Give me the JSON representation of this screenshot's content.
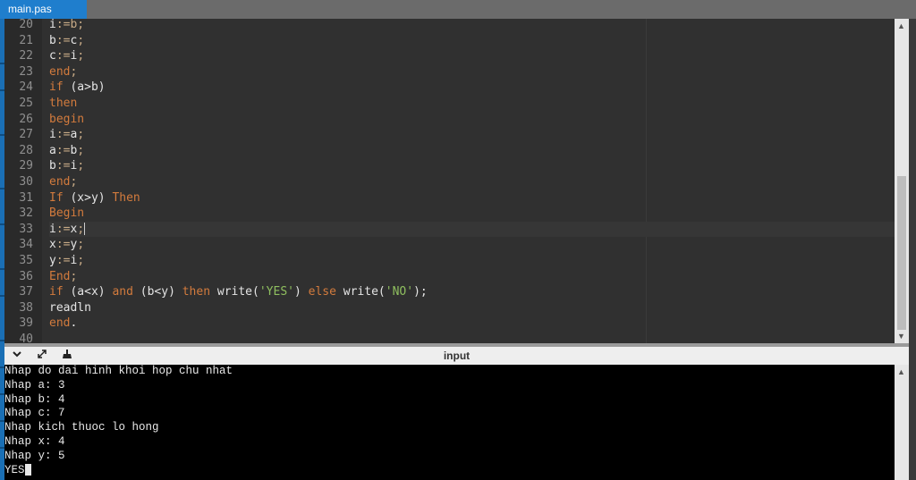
{
  "tab": {
    "filename": "main.pas"
  },
  "editor": {
    "line_numbers": [
      "20",
      "21",
      "22",
      "23",
      "24",
      "25",
      "26",
      "27",
      "28",
      "29",
      "30",
      "31",
      "32",
      "33",
      "34",
      "35",
      "36",
      "37",
      "38",
      "39",
      "40"
    ],
    "lines": [
      [
        {
          "t": "i",
          "c": "id"
        },
        {
          "t": ":=b;",
          "c": "op"
        }
      ],
      [
        {
          "t": "b",
          "c": "id"
        },
        {
          "t": ":=",
          "c": "op"
        },
        {
          "t": "c",
          "c": "id"
        },
        {
          "t": ";",
          "c": "op"
        }
      ],
      [
        {
          "t": "c",
          "c": "id"
        },
        {
          "t": ":=",
          "c": "op"
        },
        {
          "t": "i",
          "c": "id"
        },
        {
          "t": ";",
          "c": "op"
        }
      ],
      [
        {
          "t": "end",
          "c": "kw"
        },
        {
          "t": ";",
          "c": "op"
        }
      ],
      [
        {
          "t": "if",
          "c": "kw"
        },
        {
          "t": " (a>b)",
          "c": "id"
        }
      ],
      [
        {
          "t": "then",
          "c": "kw"
        }
      ],
      [
        {
          "t": "begin",
          "c": "kw"
        }
      ],
      [
        {
          "t": "i",
          "c": "id"
        },
        {
          "t": ":=",
          "c": "op"
        },
        {
          "t": "a",
          "c": "id"
        },
        {
          "t": ";",
          "c": "op"
        }
      ],
      [
        {
          "t": "a",
          "c": "id"
        },
        {
          "t": ":=",
          "c": "op"
        },
        {
          "t": "b",
          "c": "id"
        },
        {
          "t": ";",
          "c": "op"
        }
      ],
      [
        {
          "t": "b",
          "c": "id"
        },
        {
          "t": ":=",
          "c": "op"
        },
        {
          "t": "i",
          "c": "id"
        },
        {
          "t": ";",
          "c": "op"
        }
      ],
      [
        {
          "t": "end",
          "c": "kw"
        },
        {
          "t": ";",
          "c": "op"
        }
      ],
      [
        {
          "t": "If",
          "c": "kw"
        },
        {
          "t": " (x>y) ",
          "c": "id"
        },
        {
          "t": "Then",
          "c": "kw"
        }
      ],
      [
        {
          "t": "Begin",
          "c": "kw"
        }
      ],
      [
        {
          "t": "i",
          "c": "id"
        },
        {
          "t": ":=",
          "c": "op"
        },
        {
          "t": "x",
          "c": "id"
        },
        {
          "t": ";",
          "c": "op"
        }
      ],
      [
        {
          "t": "x",
          "c": "id"
        },
        {
          "t": ":=",
          "c": "op"
        },
        {
          "t": "y",
          "c": "id"
        },
        {
          "t": ";",
          "c": "op"
        }
      ],
      [
        {
          "t": "y",
          "c": "id"
        },
        {
          "t": ":=",
          "c": "op"
        },
        {
          "t": "i",
          "c": "id"
        },
        {
          "t": ";",
          "c": "op"
        }
      ],
      [
        {
          "t": "End",
          "c": "kw"
        },
        {
          "t": ";",
          "c": "op"
        }
      ],
      [
        {
          "t": "if",
          "c": "kw"
        },
        {
          "t": " (a<x) ",
          "c": "id"
        },
        {
          "t": "and",
          "c": "kw"
        },
        {
          "t": " (b<y) ",
          "c": "id"
        },
        {
          "t": "then",
          "c": "kw"
        },
        {
          "t": " write(",
          "c": "id"
        },
        {
          "t": "'YES'",
          "c": "str"
        },
        {
          "t": ") ",
          "c": "id"
        },
        {
          "t": "else",
          "c": "kw"
        },
        {
          "t": " write(",
          "c": "id"
        },
        {
          "t": "'NO'",
          "c": "str"
        },
        {
          "t": ");",
          "c": "id"
        }
      ],
      [
        {
          "t": "readln",
          "c": "id"
        }
      ],
      [
        {
          "t": "end",
          "c": "kw"
        },
        {
          "t": ".",
          "c": "id"
        }
      ],
      []
    ],
    "active_line": "33"
  },
  "panel": {
    "title": "input"
  },
  "console": {
    "lines": [
      "Nhap do dai hinh khoi hop chu nhat",
      "Nhap a: 3",
      "Nhap b: 4",
      "Nhap c: 7",
      "Nhap kich thuoc lo hong",
      "Nhap x: 4",
      "Nhap y: 5",
      "YES"
    ]
  },
  "colors": {
    "tab_active": "#1f7ecd",
    "keyword": "#d37b3d",
    "string": "#8fbf5f",
    "console_bg": "#000000"
  },
  "icons": {
    "collapse": "chevron-down-icon",
    "expand": "expand-arrows-icon",
    "clear": "broom-icon"
  }
}
